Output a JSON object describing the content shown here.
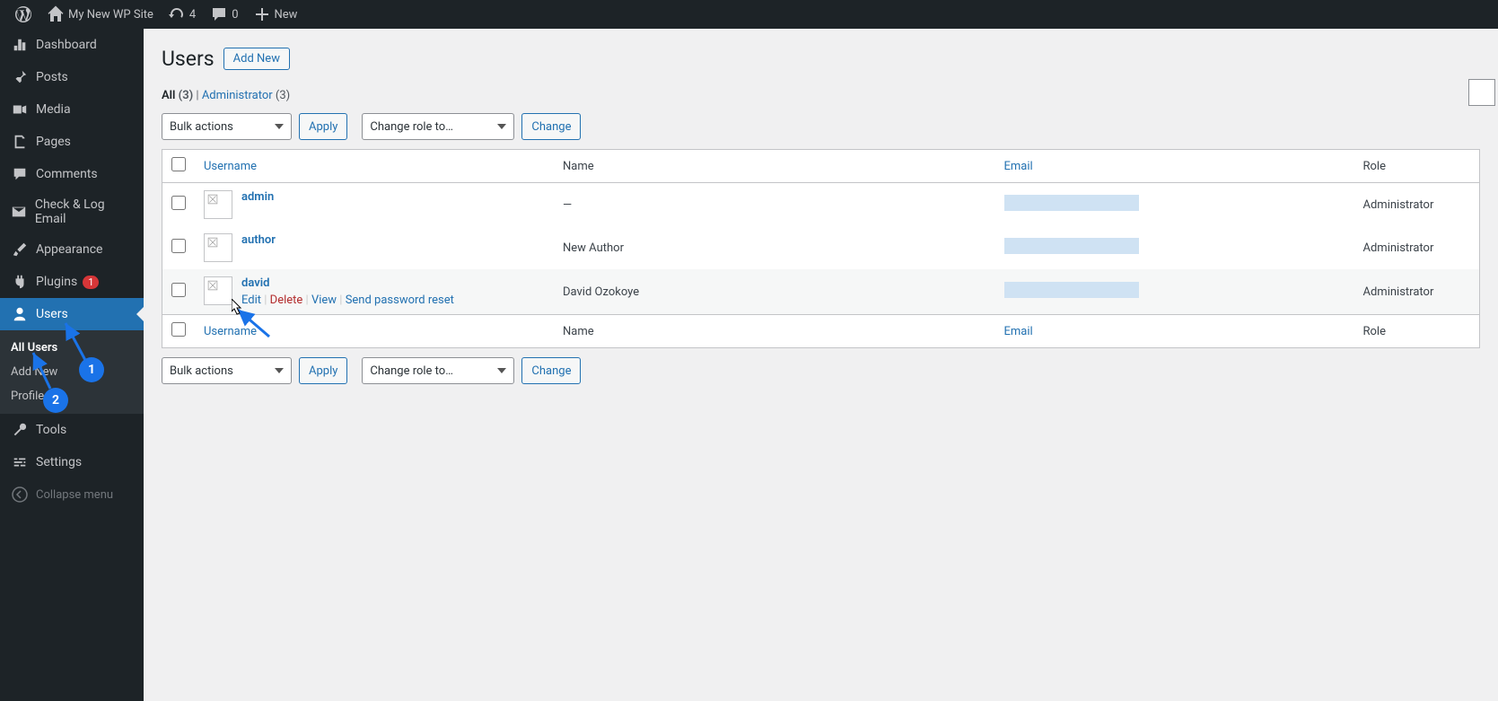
{
  "topbar": {
    "site_name": "My New WP Site",
    "updates_count": "4",
    "comments_count": "0",
    "new_label": "New"
  },
  "sidebar": {
    "items": [
      {
        "label": "Dashboard"
      },
      {
        "label": "Posts"
      },
      {
        "label": "Media"
      },
      {
        "label": "Pages"
      },
      {
        "label": "Comments"
      },
      {
        "label": "Check & Log Email"
      },
      {
        "label": "Appearance"
      },
      {
        "label": "Plugins",
        "badge": "1"
      },
      {
        "label": "Users"
      },
      {
        "label": "Tools"
      },
      {
        "label": "Settings"
      }
    ],
    "users_submenu": [
      {
        "label": "All Users"
      },
      {
        "label": "Add New"
      },
      {
        "label": "Profile"
      }
    ],
    "collapse_label": "Collapse menu"
  },
  "page": {
    "title": "Users",
    "add_new_btn": "Add New"
  },
  "filter": {
    "all_label": "All",
    "all_count": "(3)",
    "sep": " | ",
    "admin_label": "Administrator",
    "admin_count": "(3)"
  },
  "controls": {
    "bulk_actions": "Bulk actions",
    "apply_btn": "Apply",
    "change_role": "Change role to…",
    "change_btn": "Change"
  },
  "table": {
    "col_username": "Username",
    "col_name": "Name",
    "col_email": "Email",
    "col_role": "Role",
    "rows": [
      {
        "username": "admin",
        "name": "—",
        "role": "Administrator"
      },
      {
        "username": "author",
        "name": "New Author",
        "role": "Administrator"
      },
      {
        "username": "david",
        "name": "David Ozokoye",
        "role": "Administrator"
      }
    ],
    "row_actions": {
      "edit": "Edit",
      "delete": "Delete",
      "view": "View",
      "reset": "Send password reset"
    }
  },
  "annotations": {
    "one": "1",
    "two": "2"
  }
}
